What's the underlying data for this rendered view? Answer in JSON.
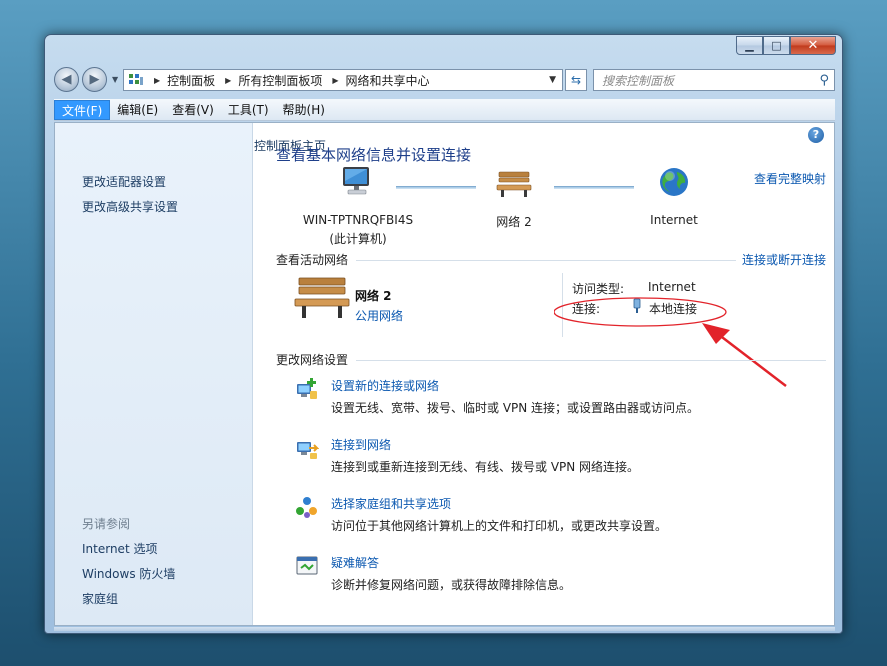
{
  "window": {
    "minimize_label": "▁",
    "maximize_label": "□",
    "close_label": "✕"
  },
  "address_bar": {
    "breadcrumbs": [
      "控制面板",
      "所有控制面板项",
      "网络和共享中心"
    ],
    "search_placeholder": "搜索控制面板"
  },
  "menu": {
    "items": [
      "文件(F)",
      "编辑(E)",
      "查看(V)",
      "工具(T)",
      "帮助(H)"
    ],
    "active_index": 0
  },
  "sidebar": {
    "home_link": "控制面板主页",
    "links": [
      "更改适配器设置",
      "更改高级共享设置"
    ],
    "see_also_heading": "另请参阅",
    "see_also_links": [
      "Internet 选项",
      "Windows 防火墙",
      "家庭组"
    ]
  },
  "main": {
    "title": "查看基本网络信息并设置连接",
    "view_full_map": "查看完整映射",
    "network_map": {
      "computer_name": "WIN-TPTNRQFBI4S",
      "computer_subtitle": "(此计算机)",
      "network_name": "网络  2",
      "internet_label": "Internet"
    },
    "active_networks": {
      "heading": "查看活动网络",
      "connect_disconnect": "连接或断开连接",
      "network_name": "网络  2",
      "network_category": "公用网络",
      "access_type_key": "访问类型:",
      "access_type_value": "Internet",
      "connections_key": "连接:",
      "connection_value": "本地连接"
    },
    "change_settings": {
      "heading": "更改网络设置",
      "tasks": [
        {
          "title": "设置新的连接或网络",
          "desc": "设置无线、宽带、拨号、临时或 VPN 连接；或设置路由器或访问点。",
          "icon": "new-connection-icon"
        },
        {
          "title": "连接到网络",
          "desc": "连接到或重新连接到无线、有线、拨号或 VPN 网络连接。",
          "icon": "connect-network-icon"
        },
        {
          "title": "选择家庭组和共享选项",
          "desc": "访问位于其他网络计算机上的文件和打印机，或更改共享设置。",
          "icon": "homegroup-icon"
        },
        {
          "title": "疑难解答",
          "desc": "诊断并修复网络问题，或获得故障排除信息。",
          "icon": "troubleshoot-icon"
        }
      ]
    }
  },
  "colors": {
    "link": "#0b58b0",
    "title": "#1e3f8a",
    "annotation": "#e2232a",
    "menu_active": "#3399ff"
  }
}
